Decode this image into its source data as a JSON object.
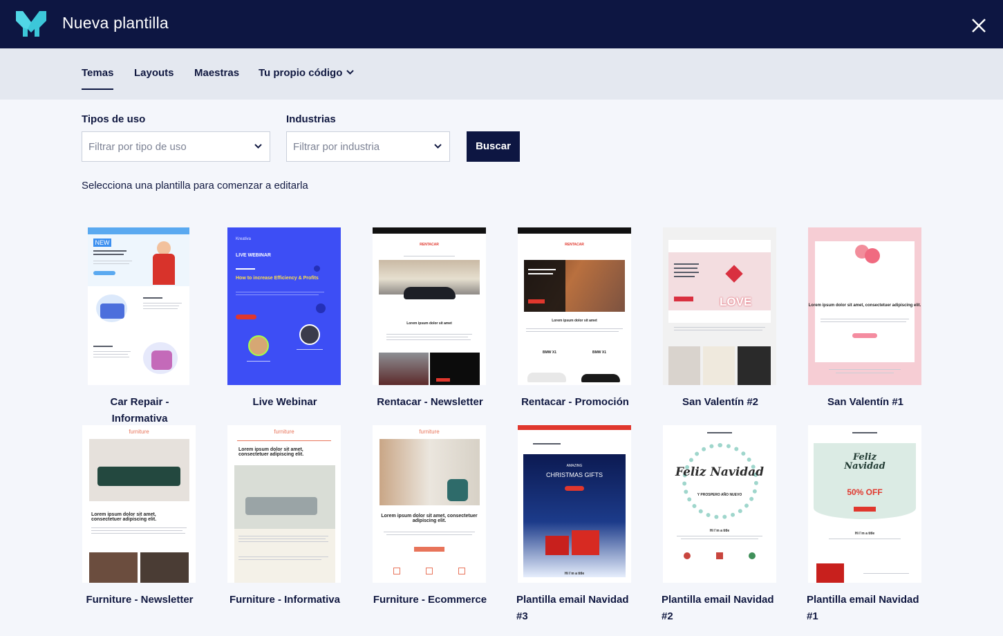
{
  "header": {
    "title": "Nueva plantilla"
  },
  "tabs": [
    {
      "label": "Temas"
    },
    {
      "label": "Layouts"
    },
    {
      "label": "Maestras"
    },
    {
      "label": "Tu propio código"
    }
  ],
  "filters": {
    "usage_label": "Tipos de uso",
    "usage_placeholder": "Filtrar por tipo de uso",
    "industry_label": "Industrias",
    "industry_placeholder": "Filtrar por industria",
    "search_button": "Buscar"
  },
  "hint": "Selecciona una plantilla para comenzar a editarla",
  "badge_new": "NEW",
  "templates": [
    {
      "name": "Car Repair - Informativa"
    },
    {
      "name": "Live Webinar"
    },
    {
      "name": "Rentacar - Newsletter"
    },
    {
      "name": "Rentacar - Promoción"
    },
    {
      "name": "San Valentín #2"
    },
    {
      "name": "San Valentín #1"
    },
    {
      "name": "Furniture - Newsletter"
    },
    {
      "name": "Furniture - Informativa"
    },
    {
      "name": "Furniture - Ecommerce"
    },
    {
      "name": "Plantilla email Navidad #3"
    },
    {
      "name": "Plantilla email Navidad #2"
    },
    {
      "name": "Plantilla email Navidad #1"
    }
  ],
  "thumb_text": {
    "kreativa": "Kreativa",
    "live_webinar": "LIVE WEBINAR",
    "webinar_sub": "How to increase Efficiency & Profits",
    "rentacar": "RENTACAR",
    "lorem_short": "Lorem ipsum dolor sit amet",
    "lorem_long": "Lorem ipsum dolor sit amet, consectetuer adipiscing elit.",
    "bmw_x1": "BMW X1",
    "love": "LOVE",
    "furniture": "furniture",
    "amazing": "AMAZING",
    "christmas_gifts": "CHRISTMAS GIFTS",
    "feliz_navidad": "Feliz Navidad",
    "prospero": "Y PROSPERO AÑO NUEVO",
    "off": "50% OFF",
    "hi_title": "Hi I´m a title"
  },
  "colors": {
    "header_bg": "#0d1642",
    "tabbar_bg": "#e4e8f0",
    "page_bg": "#f4f6fb",
    "logo_cyan": "#3cc7d9",
    "webinar_blue": "#3d4ef5",
    "rentacar_red": "#e0372d",
    "valentine_pink": "#f6cdd4",
    "furniture_orange": "#e8745a"
  }
}
